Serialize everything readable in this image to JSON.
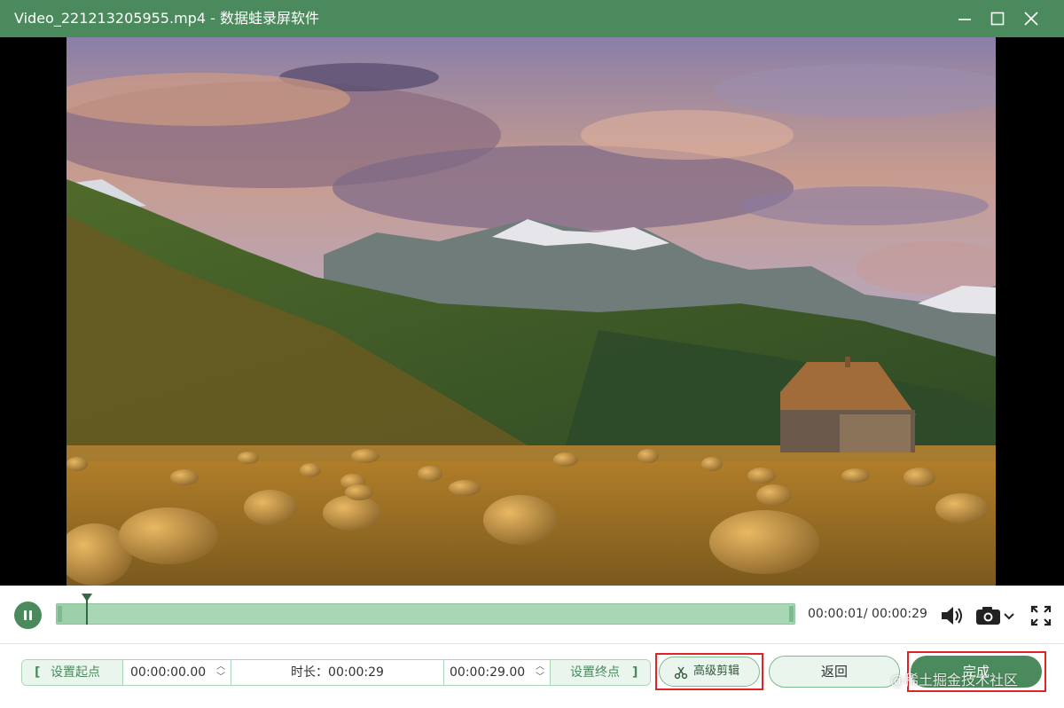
{
  "window": {
    "title": "Video_221213205955.mp4  -  数据蛙录屏软件"
  },
  "playback": {
    "time": "00:00:01/ 00:00:29",
    "progress_fraction": 0.042
  },
  "trim": {
    "set_start_label": "设置起点",
    "start_bracket": "[",
    "start_time": "00:00:00.00",
    "duration_text": "时长：00:00:29",
    "end_time": "00:00:29.00",
    "set_end_label": "设置终点",
    "end_bracket": "]"
  },
  "buttons": {
    "advanced_edit": "高级剪辑",
    "back": "返回",
    "done": "完成"
  },
  "watermark": "@稀土掘金技术社区",
  "colors": {
    "accent": "#4b8a5c",
    "timeline": "#a9d6b5",
    "highlight_box": "#e02424"
  },
  "icons": {
    "play_pause": "pause-icon",
    "volume": "volume-icon",
    "screenshot": "camera-icon",
    "fullscreen": "fullscreen-icon",
    "advanced": "scissors-icon"
  }
}
